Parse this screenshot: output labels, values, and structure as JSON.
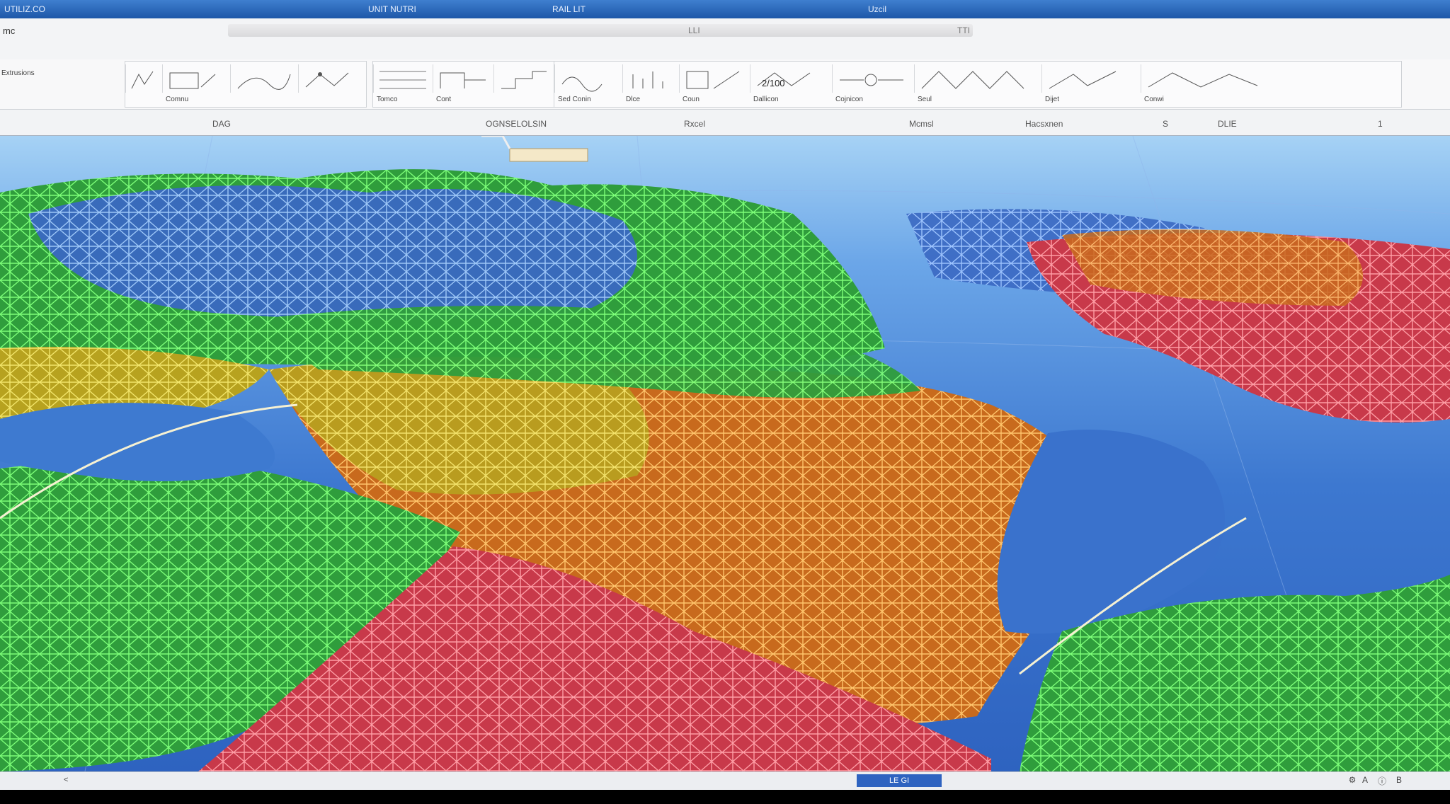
{
  "window": {
    "title_left": "UTILIZ.CO",
    "title_mid": "UNIT NUTRI",
    "title_center": "RAIL LIT",
    "title_right": "Uzcil"
  },
  "menu": {
    "app_name": "mc",
    "doc_title": "LLI",
    "doc_right": "TTI"
  },
  "ribbon": {
    "panel_label": "Extrusions",
    "value_display": "2/100",
    "tool_captions": [
      "Comnu",
      "Tomco",
      "Cont",
      "Sed Conin",
      "Dlce",
      "Coun",
      "Dallicon",
      "Cojnicon",
      "Seul",
      "Dijet",
      "Conwi"
    ]
  },
  "status": {
    "label_dag": "DAG",
    "label_center": "OGNSELOLSIN",
    "label_mid": "Rxcel",
    "label_right1": "Mcmsl",
    "label_right2": "Hacsxnen",
    "label_right3": "DLIE",
    "label_s": "S",
    "label_1": "1"
  },
  "bottom": {
    "left_arrow": "<",
    "tab_label": "LE GI",
    "icons": [
      "gear-icon",
      "a-icon",
      "info-icon",
      "b-icon"
    ]
  },
  "colors": {
    "sea": "#2e63c0",
    "green": "#3fc53a",
    "blue": "#4f7fd6",
    "orange": "#e88a2a",
    "red": "#e24a55"
  }
}
